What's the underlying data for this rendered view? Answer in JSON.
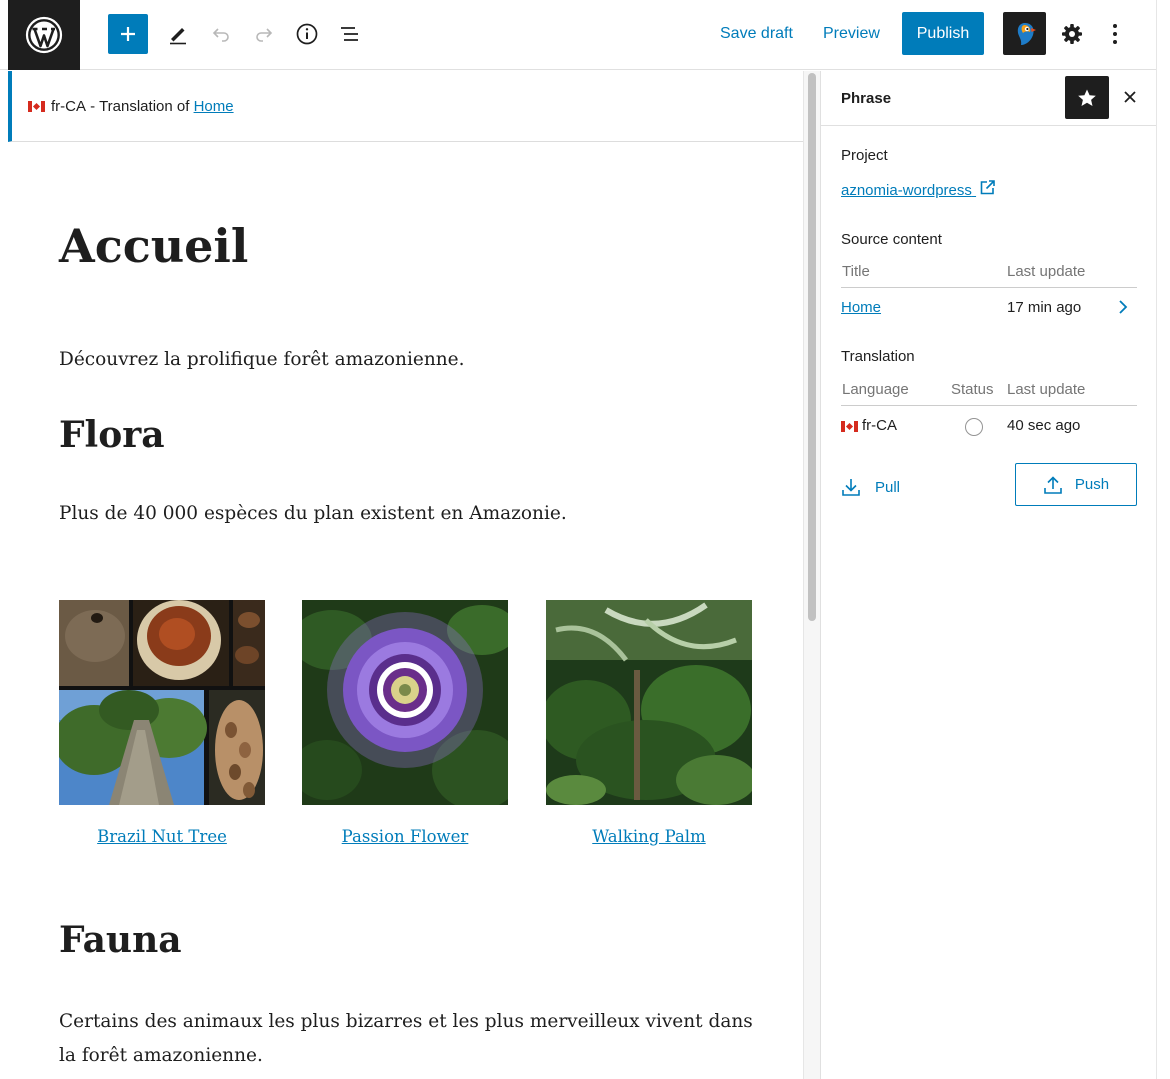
{
  "toolbar": {
    "save_draft": "Save draft",
    "preview": "Preview",
    "publish": "Publish",
    "icons": [
      "wordpress-logo",
      "plus-icon",
      "pencil-icon",
      "undo-icon",
      "redo-icon",
      "info-icon",
      "list-view-icon",
      "phrase-parrot-icon",
      "gear-icon",
      "more-vertical-icon"
    ]
  },
  "notice": {
    "locale": "fr-CA",
    "text": "- Translation of",
    "link": "Home"
  },
  "content": {
    "title": "Accueil",
    "intro": "Découvrez la prolifique forêt amazonienne.",
    "flora_heading": "Flora",
    "flora_text": "Plus de 40 000 espèces du plan existent en Amazonie.",
    "gallery": [
      {
        "caption": "Brazil Nut Tree"
      },
      {
        "caption": "Passion Flower"
      },
      {
        "caption": "Walking Palm"
      }
    ],
    "fauna_heading": "Fauna",
    "fauna_text": "Certains des animaux les plus bizarres et les plus merveilleux vivent dans la forêt amazonienne."
  },
  "sidebar": {
    "title": "Phrase",
    "project_label": "Project",
    "project_link": "aznomia-wordpress",
    "source_label": "Source content",
    "source_headers": {
      "title": "Title",
      "last_update": "Last update"
    },
    "source_row": {
      "title": "Home",
      "last_update": "17 min ago"
    },
    "translation_label": "Translation",
    "translation_headers": {
      "language": "Language",
      "status": "Status",
      "last_update": "Last update"
    },
    "translation_row": {
      "language": "fr-CA",
      "last_update": "40 sec ago"
    },
    "pull": "Pull",
    "push": "Push"
  },
  "colors": {
    "accent": "#007cba",
    "dark": "#1e1e1e",
    "flag_red": "#d52b1e"
  }
}
